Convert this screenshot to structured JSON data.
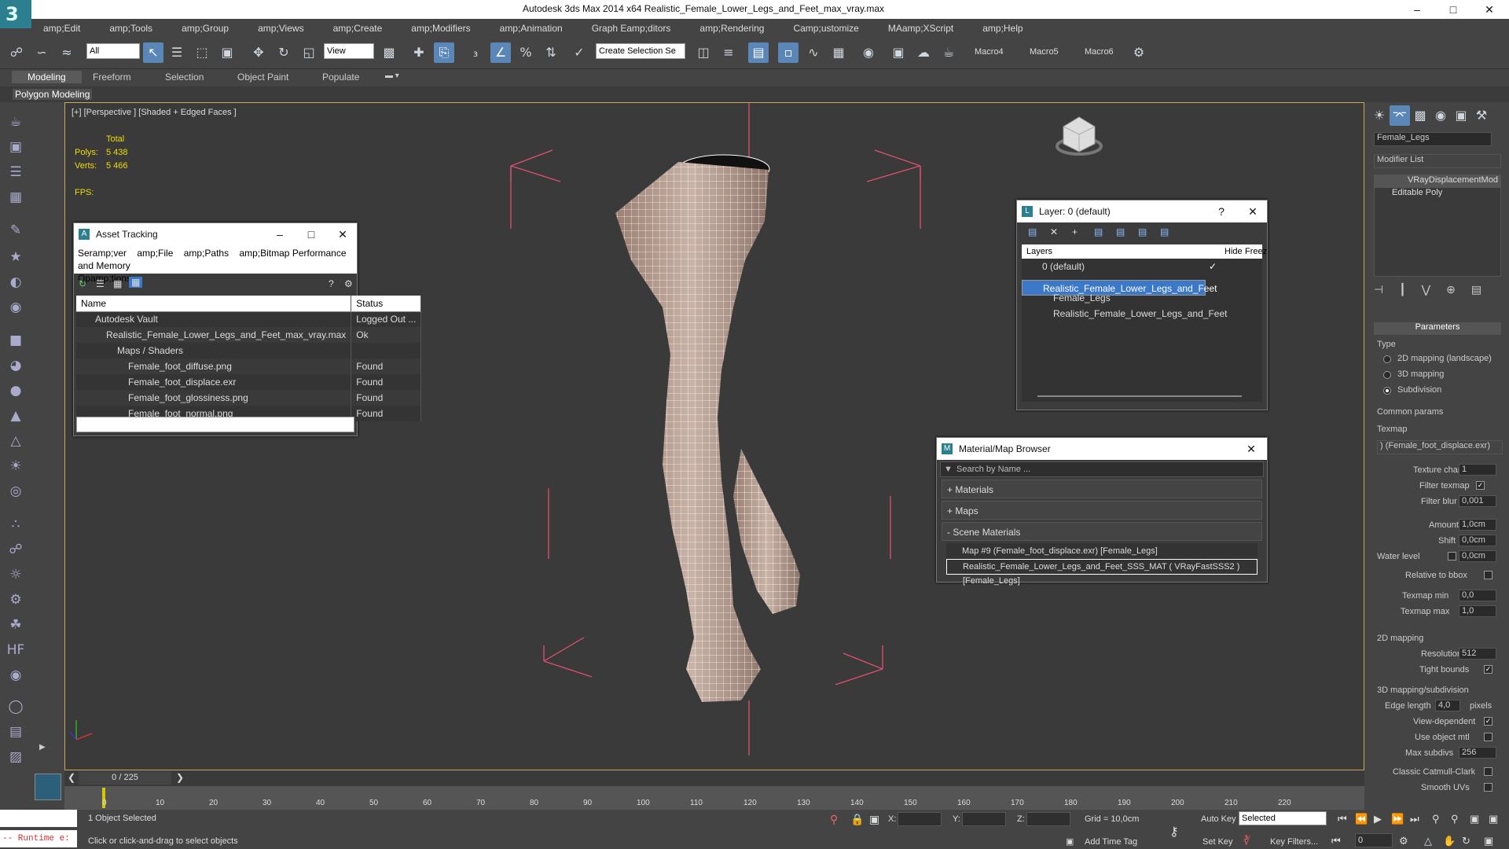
{
  "app": {
    "title": "Autodesk 3ds Max  2014 x64     Realistic_Female_Lower_Legs_and_Feet_max_vray.max"
  },
  "menu": [
    "amp;Edit",
    "amp;Tools",
    "amp;Group",
    "amp;Views",
    "amp;Create",
    "amp;Modifiers",
    "amp;Animation",
    "Graph Eamp;ditors",
    "amp;Rendering",
    "Camp;ustomize",
    "MAamp;XScript",
    "amp;Help"
  ],
  "toolbar": {
    "filter": "All",
    "refcoord": "View",
    "named_sel": "Create Selection Se",
    "macros": [
      "Macro4",
      "Macro5",
      "Macro6"
    ]
  },
  "ribbon": {
    "tabs": [
      "Modeling",
      "Freeform",
      "Selection",
      "Object Paint",
      "Populate"
    ],
    "active": "Modeling",
    "sub": "Polygon Modeling"
  },
  "viewport": {
    "label": "[+] [Perspective ] [Shaded + Edged Faces ]",
    "stats": {
      "header": "Total",
      "polys_label": "Polys:",
      "polys": "5 438",
      "verts_label": "Verts:",
      "verts": "5 466",
      "fps": "FPS:"
    }
  },
  "asset_tracking": {
    "title": "Asset Tracking",
    "menu1": [
      "Seramp;ver",
      "amp;File",
      "amp;Paths",
      "amp;Bitmap Performance and Memory"
    ],
    "menu2": "Opamp;tions",
    "col_name": "Name",
    "col_status": "Status",
    "rows": [
      {
        "name": "Autodesk Vault",
        "status": "Logged Out ...",
        "indent": 1
      },
      {
        "name": "Realistic_Female_Lower_Legs_and_Feet_max_vray.max",
        "status": "Ok",
        "indent": 2
      },
      {
        "name": "Maps / Shaders",
        "status": "",
        "indent": 3
      },
      {
        "name": "Female_foot_diffuse.png",
        "status": "Found",
        "indent": 4
      },
      {
        "name": "Female_foot_displace.exr",
        "status": "Found",
        "indent": 4
      },
      {
        "name": "Female_foot_glossiness.png",
        "status": "Found",
        "indent": 4
      },
      {
        "name": "Female_foot_normal.png",
        "status": "Found",
        "indent": 4
      }
    ]
  },
  "layer": {
    "title": "Layer: 0 (default)",
    "help": "?",
    "col_layers": "Layers",
    "col_hide": "Hide",
    "col_freeze": "Freez",
    "rows": [
      "0 (default)",
      "Realistic_Female_Lower_Legs_and_Feet",
      "Female_Legs",
      "Realistic_Female_Lower_Legs_and_Feet"
    ]
  },
  "material_browser": {
    "title": "Material/Map Browser",
    "search": "Search by Name ...",
    "sections": [
      "+ Materials",
      "+ Maps",
      "- Scene Materials"
    ],
    "items": [
      "Map #9 (Female_foot_displace.exr) [Female_Legs]",
      "Realistic_Female_Lower_Legs_and_Feet_SSS_MAT  ( VRayFastSSS2 ) [Female_Legs]"
    ]
  },
  "cmd": {
    "object_name": "Female_Legs",
    "modifier_list": "Modifier List",
    "stack": [
      "VRayDisplacementMod",
      "Editable Poly"
    ],
    "params_title": "Parameters",
    "type_label": "Type",
    "types": [
      "2D mapping (landscape)",
      "3D mapping",
      "Subdivision"
    ],
    "common": "Common params",
    "texmap_label": "Texmap",
    "texmap": ") (Female_foot_displace.exr)",
    "texture_chan_label": "Texture chan",
    "texture_chan": "1",
    "filter_texmap": "Filter texmap",
    "filter_blur_label": "Filter blur",
    "filter_blur": "0,001",
    "amount_label": "Amount",
    "amount": "1,0cm",
    "shift_label": "Shift",
    "shift": "0,0cm",
    "water_label": "Water level",
    "water": "0,0cm",
    "rel_bbox": "Relative to bbox",
    "tmin_label": "Texmap min",
    "tmin": "0,0",
    "tmax_label": "Texmap max",
    "tmax": "1,0",
    "map2d": "2D mapping",
    "res_label": "Resolution",
    "res": "512",
    "tight": "Tight bounds",
    "map3d": "3D mapping/subdivision",
    "edge_label": "Edge length",
    "edge": "4,0",
    "pixels": "pixels",
    "viewdep": "View-dependent",
    "useobj": "Use object mtl",
    "maxsub_label": "Max subdivs",
    "maxsub": "256",
    "catmull": "Classic Catmull-Clark",
    "smoothuv": "Smooth UVs"
  },
  "timeline": {
    "frame": "0 / 225",
    "ticks": [
      "0",
      "10",
      "20",
      "30",
      "40",
      "50",
      "60",
      "70",
      "80",
      "90",
      "100",
      "110",
      "120",
      "130",
      "140",
      "150",
      "160",
      "170",
      "180",
      "190",
      "200",
      "210",
      "220"
    ]
  },
  "status": {
    "runtime": "-- Runtime e:",
    "selected": "1 Object Selected",
    "prompt": "Click or click-and-drag to select objects",
    "x": "X:",
    "y": "Y:",
    "z": "Z:",
    "grid": "Grid = 10,0cm",
    "autokey": "Auto Key",
    "selmode": "Selected",
    "setkey": "Set Key",
    "keyfilters": "Key Filters...",
    "addtime": "Add Time Tag",
    "frame_field": "0"
  },
  "colors": {
    "bg": "#444444",
    "viewport": "#3a3a3a",
    "highlight": "#3c78c8",
    "stats": "#f0dd00",
    "bbox": "#e05070"
  }
}
